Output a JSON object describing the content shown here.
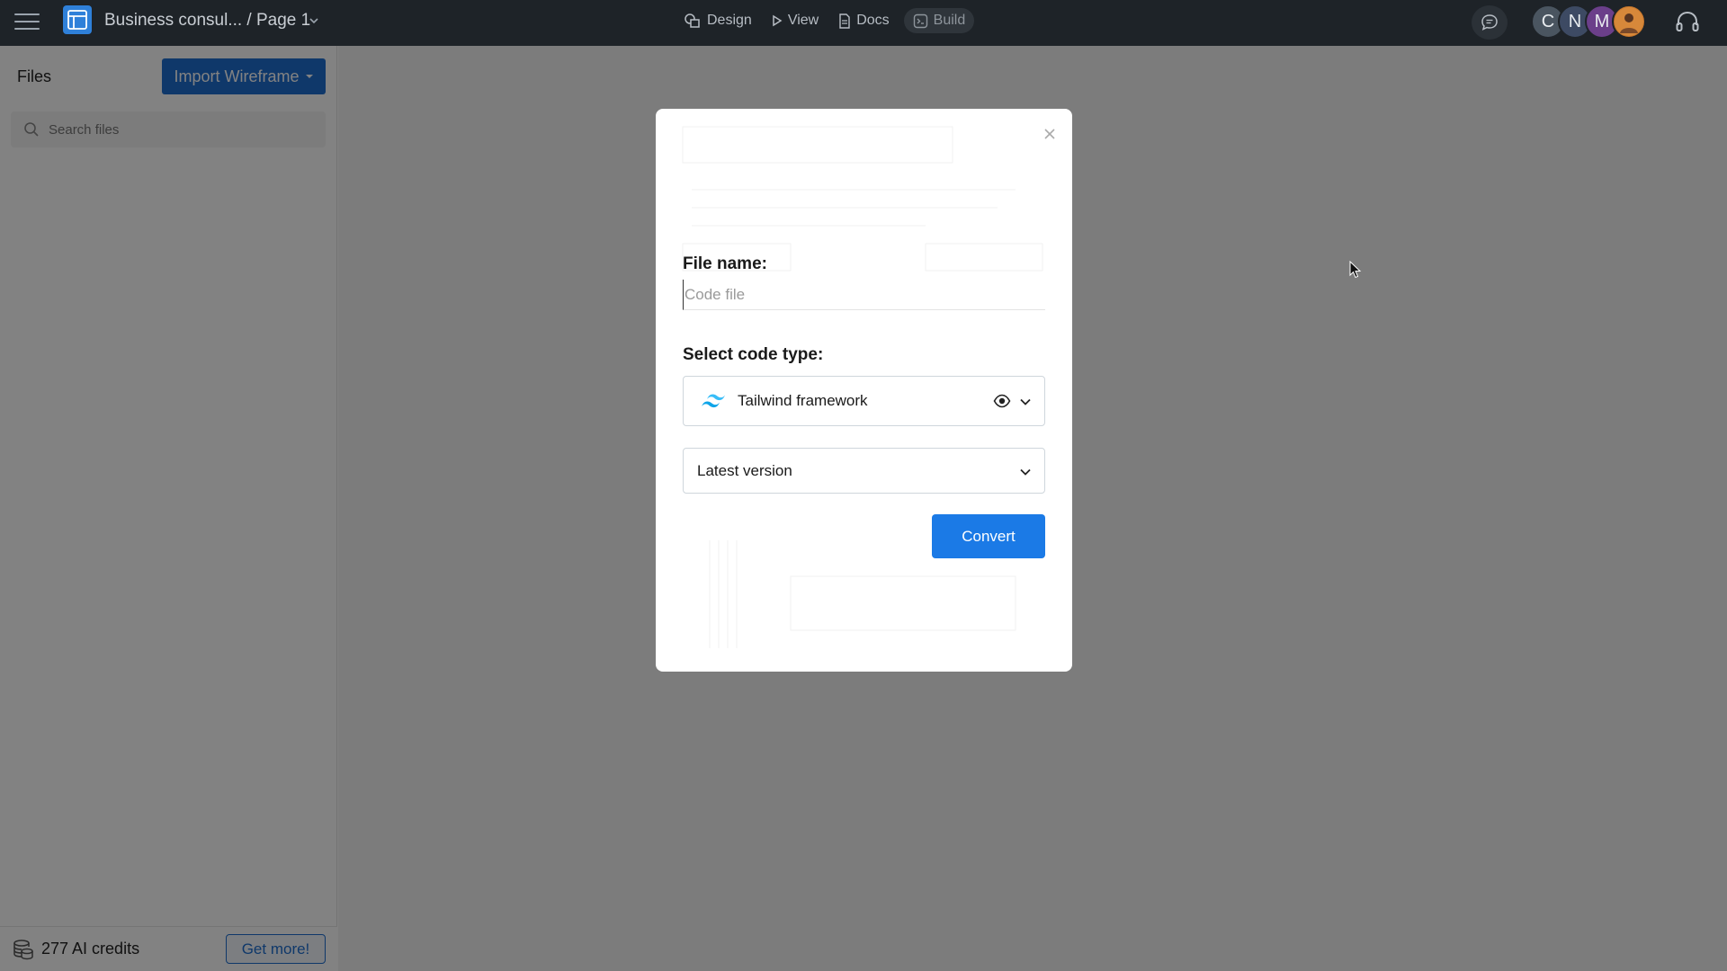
{
  "header": {
    "document_title": "Business consul... / Page 1",
    "nav": [
      {
        "label": "Design",
        "icon": "shapes-icon"
      },
      {
        "label": "View",
        "icon": "play-icon"
      },
      {
        "label": "Docs",
        "icon": "document-icon"
      },
      {
        "label": "Build",
        "icon": "code-icon"
      }
    ],
    "avatars": [
      {
        "initial": "C",
        "color": "#4a5560"
      },
      {
        "initial": "N",
        "color": "#3d4a63"
      },
      {
        "initial": "M",
        "color": "#6b3f8a"
      },
      {
        "initial": "",
        "color": "#c9772b"
      }
    ]
  },
  "sidebar": {
    "title": "Files",
    "import_button": "Import Wireframe",
    "search_placeholder": "Search files",
    "credits_text": "277 AI credits",
    "get_more_button": "Get more!"
  },
  "modal": {
    "file_name_label": "File name:",
    "file_name_placeholder": "Code file",
    "file_name_value": "",
    "code_type_label": "Select code type:",
    "code_type_selected": "Tailwind framework",
    "version_selected": "Latest version",
    "convert_button": "Convert"
  },
  "colors": {
    "topbar": "#1e2328",
    "primary": "#1b7ae6",
    "import_button": "#1f6fd1"
  }
}
